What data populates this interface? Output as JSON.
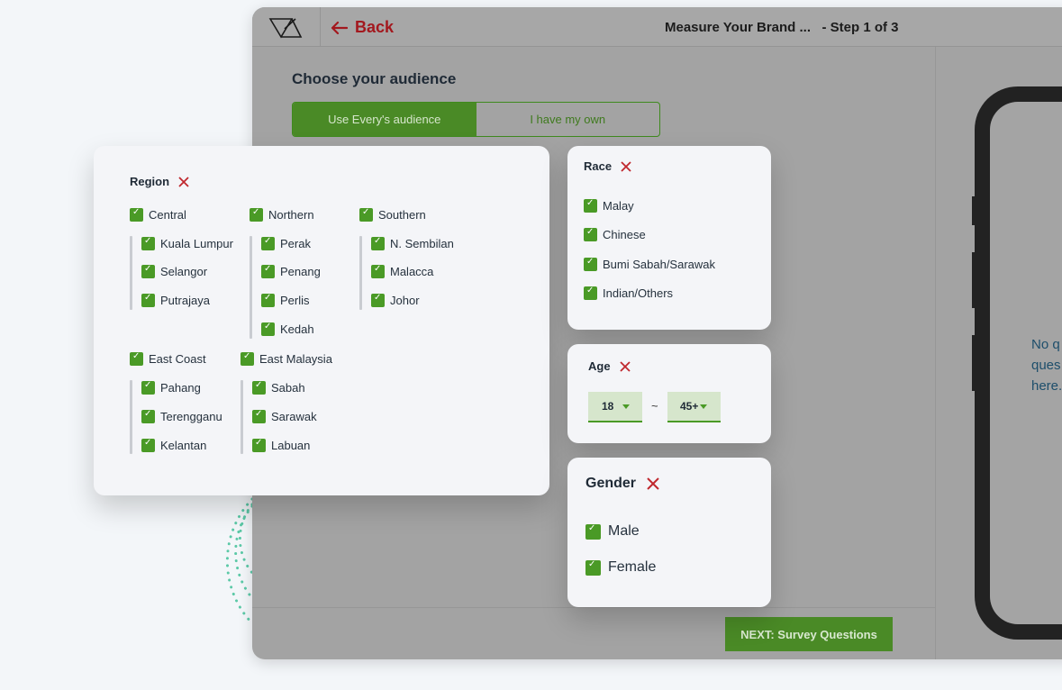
{
  "header": {
    "back_label": "Back",
    "title": "Measure Your Brand ...   - Step 1 of 3"
  },
  "audience": {
    "heading": "Choose your audience",
    "tabs": [
      {
        "label": "Use Every's audience",
        "selected": true
      },
      {
        "label": "I have my own",
        "selected": false
      }
    ]
  },
  "footer": {
    "next_label": "NEXT: Survey Questions"
  },
  "preview": {
    "empty_text": "No q\nques\nhere."
  },
  "region": {
    "title": "Region",
    "groups": [
      {
        "label": "Central",
        "items": [
          "Kuala Lumpur",
          "Selangor",
          "Putrajaya"
        ]
      },
      {
        "label": "Northern",
        "items": [
          "Perak",
          "Penang",
          "Perlis",
          "Kedah"
        ]
      },
      {
        "label": "Southern",
        "items": [
          "N. Sembilan",
          "Malacca",
          "Johor"
        ]
      },
      {
        "label": "East Coast",
        "items": [
          "Pahang",
          "Terengganu",
          "Kelantan"
        ]
      },
      {
        "label": "East Malaysia",
        "items": [
          "Sabah",
          "Sarawak",
          "Labuan"
        ]
      }
    ]
  },
  "race": {
    "title": "Race",
    "items": [
      "Malay",
      "Chinese",
      "Bumi Sabah/Sarawak",
      "Indian/Others"
    ]
  },
  "age": {
    "title": "Age",
    "from": "18",
    "separator": "~",
    "to": "45+"
  },
  "gender": {
    "title": "Gender",
    "items": [
      "Male",
      "Female"
    ]
  },
  "colors": {
    "accent_green": "#4a8a26",
    "danger_red": "#c0282e",
    "teal_dots": "#5cc9a7"
  }
}
